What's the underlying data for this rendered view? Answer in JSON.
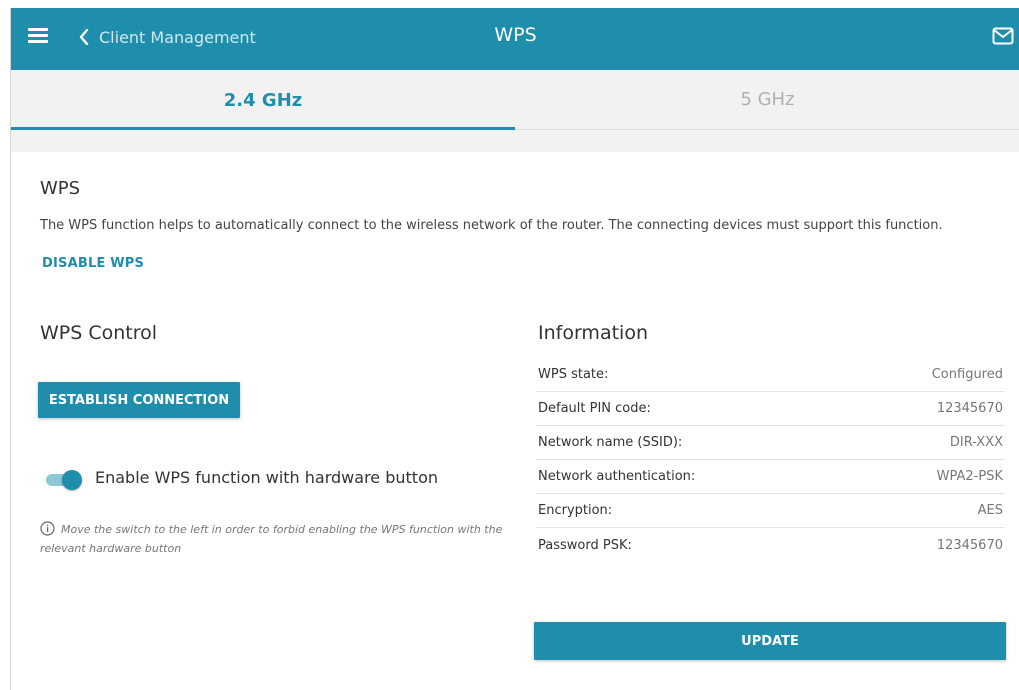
{
  "header": {
    "back_label": "Client Management",
    "title": "WPS",
    "menu_icon": "hamburger-menu-icon",
    "mail_icon": "mail-icon"
  },
  "tabs": [
    {
      "label": "2.4 GHz",
      "active": true
    },
    {
      "label": "5 GHz",
      "active": false
    }
  ],
  "wps": {
    "title": "WPS",
    "description": "The WPS function helps to automatically connect to the wireless network of the router. The connecting devices must support this function.",
    "disable_label": "DISABLE WPS"
  },
  "control": {
    "title": "WPS Control",
    "establish_label": "ESTABLISH CONNECTION",
    "toggle_label": "Enable WPS function with hardware button",
    "toggle_on": true,
    "hint": "Move the switch to the left in order to forbid enabling the WPS function with the relevant hardware button"
  },
  "information": {
    "title": "Information",
    "rows": [
      {
        "label": "WPS state:",
        "value": "Configured"
      },
      {
        "label": "Default PIN code:",
        "value": "12345670"
      },
      {
        "label": "Network name (SSID):",
        "value": "DIR-XXX"
      },
      {
        "label": "Network authentication:",
        "value": "WPA2-PSK"
      },
      {
        "label": "Encryption:",
        "value": "AES"
      },
      {
        "label": "Password PSK:",
        "value": "12345670"
      }
    ],
    "update_label": "UPDATE"
  },
  "colors": {
    "accent": "#1f8ead",
    "tab_background": "#f2f2f2"
  }
}
